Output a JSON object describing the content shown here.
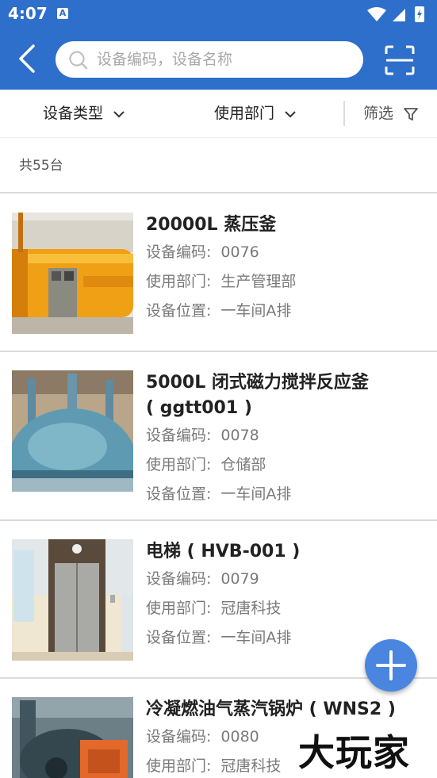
{
  "status_bar": {
    "time": "4:07",
    "notification_icon": "A"
  },
  "header": {
    "search_placeholder": "设备编码，设备名称",
    "back_icon": "chevron-left-icon",
    "scan_icon": "scan-icon"
  },
  "filters": {
    "type_label": "设备类型",
    "dept_label": "使用部门",
    "screen_label": "筛选"
  },
  "summary": {
    "count_text": "共55台"
  },
  "labels": {
    "code": "设备编码:",
    "dept": "使用部门:",
    "location": "设备位置:"
  },
  "items": [
    {
      "title": "20000L 蒸压釜",
      "code": "0076",
      "dept": "生产管理部",
      "location": "一车间A排"
    },
    {
      "title": "5000L 闭式磁力搅拌反应釜",
      "subtitle": "( ggtt001 )",
      "code": "0078",
      "dept": "仓储部",
      "location": "一车间A排"
    },
    {
      "title": "电梯 ( HVB-001 )",
      "code": "0079",
      "dept": "冠唐科技",
      "location": "一车间A排"
    },
    {
      "title": "冷凝燃油气蒸汽锅炉 ( WNS2 )",
      "code": "0080",
      "dept": "冠唐科技"
    }
  ],
  "watermark": "大玩家"
}
